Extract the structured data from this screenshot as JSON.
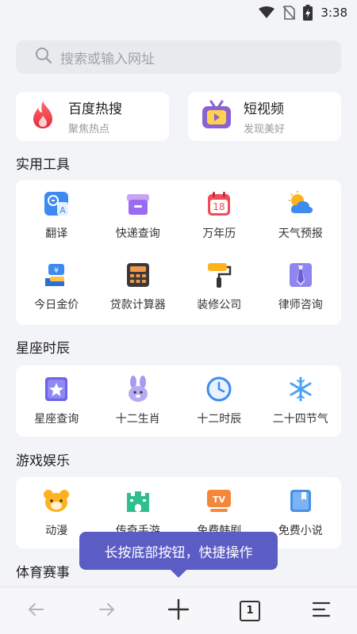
{
  "status": {
    "time": "3:38"
  },
  "search": {
    "placeholder": "搜索或输入网址"
  },
  "hot": [
    {
      "title": "百度热搜",
      "subtitle": "聚焦热点",
      "icon": "flame-icon"
    },
    {
      "title": "短视频",
      "subtitle": "发现美好",
      "icon": "tv-play-icon"
    }
  ],
  "sections": {
    "tools": {
      "title": "实用工具",
      "items": [
        {
          "label": "翻译",
          "icon": "translate-icon"
        },
        {
          "label": "快递查询",
          "icon": "package-icon"
        },
        {
          "label": "万年历",
          "icon": "calendar-icon",
          "badge": "18"
        },
        {
          "label": "天气预报",
          "icon": "weather-icon"
        },
        {
          "label": "今日金价",
          "icon": "gold-icon"
        },
        {
          "label": "贷款计算器",
          "icon": "calculator-icon"
        },
        {
          "label": "装修公司",
          "icon": "paint-roller-icon"
        },
        {
          "label": "律师咨询",
          "icon": "tie-icon"
        }
      ]
    },
    "astro": {
      "title": "星座时辰",
      "items": [
        {
          "label": "星座查询",
          "icon": "star-card-icon"
        },
        {
          "label": "十二生肖",
          "icon": "rabbit-icon"
        },
        {
          "label": "十二时辰",
          "icon": "clock-icon"
        },
        {
          "label": "二十四节气",
          "icon": "snowflake-icon"
        }
      ]
    },
    "games": {
      "title": "游戏娱乐",
      "items": [
        {
          "label": "动漫",
          "icon": "bear-icon"
        },
        {
          "label": "传奇手游",
          "icon": "castle-icon"
        },
        {
          "label": "免费韩剧",
          "icon": "tv-icon",
          "badge": "TV"
        },
        {
          "label": "免费小说",
          "icon": "book-icon"
        }
      ]
    },
    "sports": {
      "title": "体育赛事"
    }
  },
  "tooltip": {
    "text": "长按底部按钮，快捷操作"
  },
  "bottom": {
    "tab_count": "1"
  },
  "colors": {
    "accent": "#5b5cc4",
    "background": "#f3f4f7"
  }
}
